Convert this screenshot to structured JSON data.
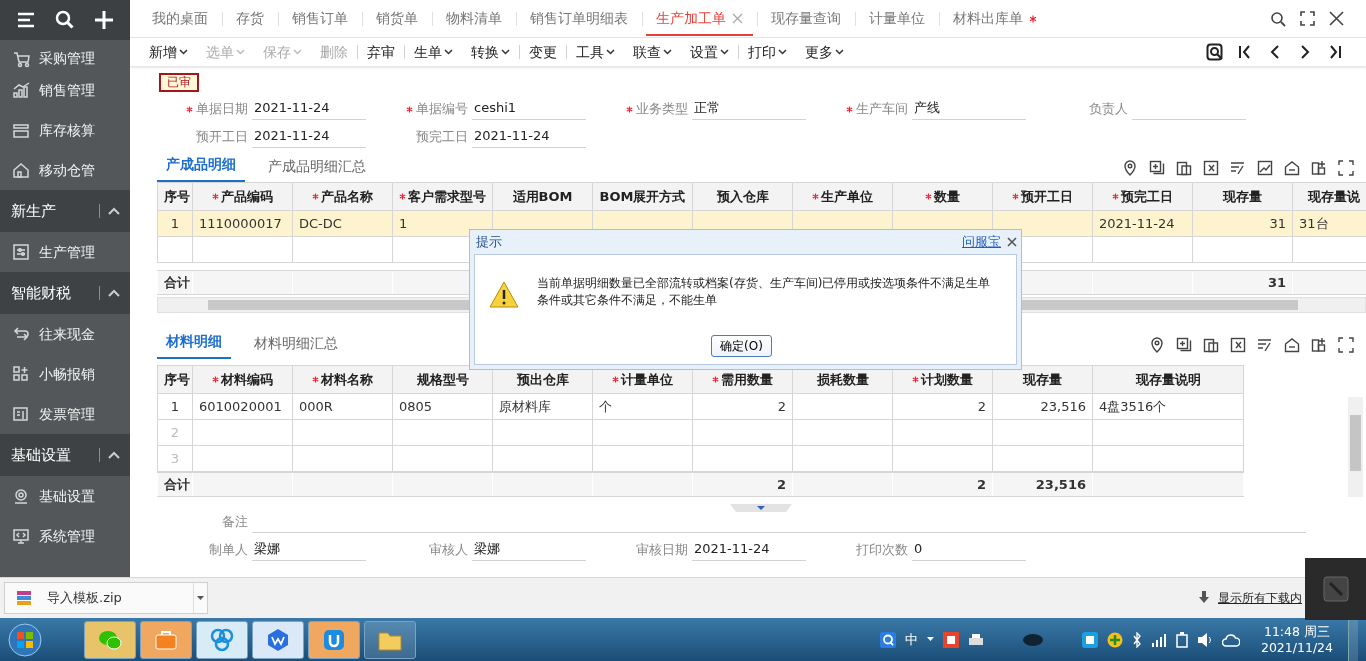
{
  "sidebar": {
    "items": [
      {
        "kind": "item",
        "label": "采购管理"
      },
      {
        "kind": "item",
        "label": "销售管理"
      },
      {
        "kind": "item",
        "label": "库存核算"
      },
      {
        "kind": "item",
        "label": "移动仓管"
      },
      {
        "kind": "group",
        "label": "新生产",
        "expanded": true
      },
      {
        "kind": "item",
        "label": "生产管理"
      },
      {
        "kind": "group",
        "label": "智能财税",
        "expanded": true
      },
      {
        "kind": "item",
        "label": "往来现金"
      },
      {
        "kind": "item",
        "label": "小畅报销"
      },
      {
        "kind": "item",
        "label": "发票管理"
      },
      {
        "kind": "group",
        "label": "基础设置",
        "expanded": true
      },
      {
        "kind": "item",
        "label": "基础设置"
      },
      {
        "kind": "item",
        "label": "系统管理"
      }
    ]
  },
  "tabs": [
    {
      "label": "我的桌面",
      "selected": false,
      "modified": false
    },
    {
      "label": "存货",
      "selected": false,
      "modified": false
    },
    {
      "label": "销售订单",
      "selected": false,
      "modified": false
    },
    {
      "label": "销货单",
      "selected": false,
      "modified": false
    },
    {
      "label": "物料清单",
      "selected": false,
      "modified": false
    },
    {
      "label": "销售订单明细表",
      "selected": false,
      "modified": false
    },
    {
      "label": "生产加工单",
      "selected": true,
      "modified": false
    },
    {
      "label": "现存量查询",
      "selected": false,
      "modified": false
    },
    {
      "label": "计量单位",
      "selected": false,
      "modified": false
    },
    {
      "label": "材料出库单",
      "selected": false,
      "modified": true
    }
  ],
  "toolbar": {
    "groups": [
      {
        "items": [
          {
            "label": "新增",
            "dropdown": true,
            "disabled": false
          },
          {
            "label": "选单",
            "dropdown": true,
            "disabled": true
          },
          {
            "label": "保存",
            "dropdown": true,
            "disabled": true
          },
          {
            "label": "删除",
            "dropdown": false,
            "disabled": true
          }
        ]
      },
      {
        "items": [
          {
            "label": "弃审",
            "dropdown": false,
            "disabled": false
          }
        ]
      },
      {
        "items": [
          {
            "label": "生单",
            "dropdown": true,
            "disabled": false
          },
          {
            "label": "转换",
            "dropdown": true,
            "disabled": false
          }
        ]
      },
      {
        "items": [
          {
            "label": "变更",
            "dropdown": false,
            "disabled": false
          }
        ]
      },
      {
        "items": [
          {
            "label": "工具",
            "dropdown": true,
            "disabled": false
          },
          {
            "label": "联查",
            "dropdown": true,
            "disabled": false
          },
          {
            "label": "设置",
            "dropdown": true,
            "disabled": false
          }
        ]
      },
      {
        "items": [
          {
            "label": "打印",
            "dropdown": true,
            "disabled": false
          },
          {
            "label": "更多",
            "dropdown": true,
            "disabled": false
          }
        ]
      }
    ]
  },
  "status_badge": "已审",
  "form": {
    "rows": [
      [
        {
          "label": "单据日期",
          "required": true,
          "value": "2021-11-24"
        },
        {
          "label": "单据编号",
          "required": true,
          "value": "ceshi1"
        },
        {
          "label": "业务类型",
          "required": true,
          "value": "正常"
        },
        {
          "label": "生产车间",
          "required": true,
          "value": "产线"
        },
        {
          "label": "负责人",
          "required": false
        }
      ],
      [
        {
          "label": "预开工日",
          "required": false,
          "value": "2021-11-24"
        },
        {
          "label": "预完工日",
          "required": false,
          "value": "2021-11-24"
        }
      ]
    ]
  },
  "product_section": {
    "tabs": [
      {
        "label": "产成品明细",
        "selected": true
      },
      {
        "label": "产成品明细汇总",
        "selected": false
      }
    ],
    "table": {
      "rows": [
        {
          "selected": true
        },
        {
          "selected": false
        }
      ],
      "columns": [
        {
          "label": "序号",
          "required": false,
          "cells": [
            "1"
          ],
          "total": "合计"
        },
        {
          "label": "产品编码",
          "required": true,
          "numeric": false,
          "cells": [
            "1110000017"
          ]
        },
        {
          "label": "产品名称",
          "required": true,
          "numeric": false,
          "cells": [
            "DC-DC"
          ]
        },
        {
          "label": "客户需求型号",
          "required": true,
          "numeric": false,
          "cells": [
            "1"
          ]
        },
        {
          "label": "适用BOM",
          "required": false
        },
        {
          "label": "BOM展开方式",
          "required": false
        },
        {
          "label": "预入仓库",
          "required": false
        },
        {
          "label": "生产单位",
          "required": true
        },
        {
          "label": "数量",
          "required": true
        },
        {
          "label": "预开工日",
          "required": true
        },
        {
          "label": "预完工日",
          "required": true,
          "numeric": false,
          "cells": [
            "2021-11-24"
          ]
        },
        {
          "label": "现存量",
          "required": false,
          "numeric": true,
          "cells": [
            "31"
          ],
          "total": "31"
        },
        {
          "label": "现存量说",
          "required": false,
          "numeric": false,
          "cells": [
            "31台"
          ]
        }
      ]
    }
  },
  "material_section": {
    "tabs": [
      {
        "label": "材料明细",
        "selected": true
      },
      {
        "label": "材料明细汇总",
        "selected": false
      }
    ],
    "table": {
      "rows": [
        {
          "selected": false
        },
        {
          "selected": false
        },
        {
          "selected": false
        }
      ],
      "columns": [
        {
          "label": "序号",
          "required": false,
          "cells": [
            "1",
            "2",
            "3"
          ],
          "total": "合计"
        },
        {
          "label": "材料编码",
          "required": true,
          "numeric": false,
          "cells": [
            "6010020001"
          ]
        },
        {
          "label": "材料名称",
          "required": true,
          "numeric": false,
          "cells": [
            "000R"
          ]
        },
        {
          "label": "规格型号",
          "required": false,
          "numeric": false,
          "cells": [
            "0805"
          ]
        },
        {
          "label": "预出仓库",
          "required": false,
          "numeric": false,
          "cells": [
            "原材料库"
          ]
        },
        {
          "label": "计量单位",
          "required": true,
          "numeric": false,
          "cells": [
            "个"
          ]
        },
        {
          "label": "需用数量",
          "required": true,
          "numeric": true,
          "cells": [
            "2"
          ],
          "total": "2"
        },
        {
          "label": "损耗数量",
          "required": false
        },
        {
          "label": "计划数量",
          "required": true,
          "numeric": true,
          "cells": [
            "2"
          ],
          "total": "2"
        },
        {
          "label": "现存量",
          "required": false,
          "numeric": true,
          "cells": [
            "23,516"
          ],
          "total": "23,516"
        },
        {
          "label": "现存量说明",
          "required": false,
          "numeric": false,
          "cells": [
            "4盘3516个"
          ]
        }
      ]
    }
  },
  "footer": {
    "remark": {
      "label": "备注"
    },
    "fields": [
      {
        "label": "制单人",
        "value": "梁娜"
      },
      {
        "label": "审核人",
        "value": "梁娜"
      },
      {
        "label": "审核日期",
        "value": "2021-11-24"
      },
      {
        "label": "打印次数",
        "value": "0"
      }
    ]
  },
  "dialog": {
    "title": "提示",
    "help_link": "问服宝",
    "message": "当前单据明细数量已全部流转或档案(存货、生产车间)已停用或按选项条件不满足生单条件或其它条件不满足，不能生单",
    "button": "确定(O)"
  },
  "download_bar": {
    "file": "导入模板.zip",
    "show_all": "显示所有下载内"
  },
  "taskbar": {
    "ime": "中",
    "time": "11:48 周三",
    "date": "2021/11/24"
  }
}
